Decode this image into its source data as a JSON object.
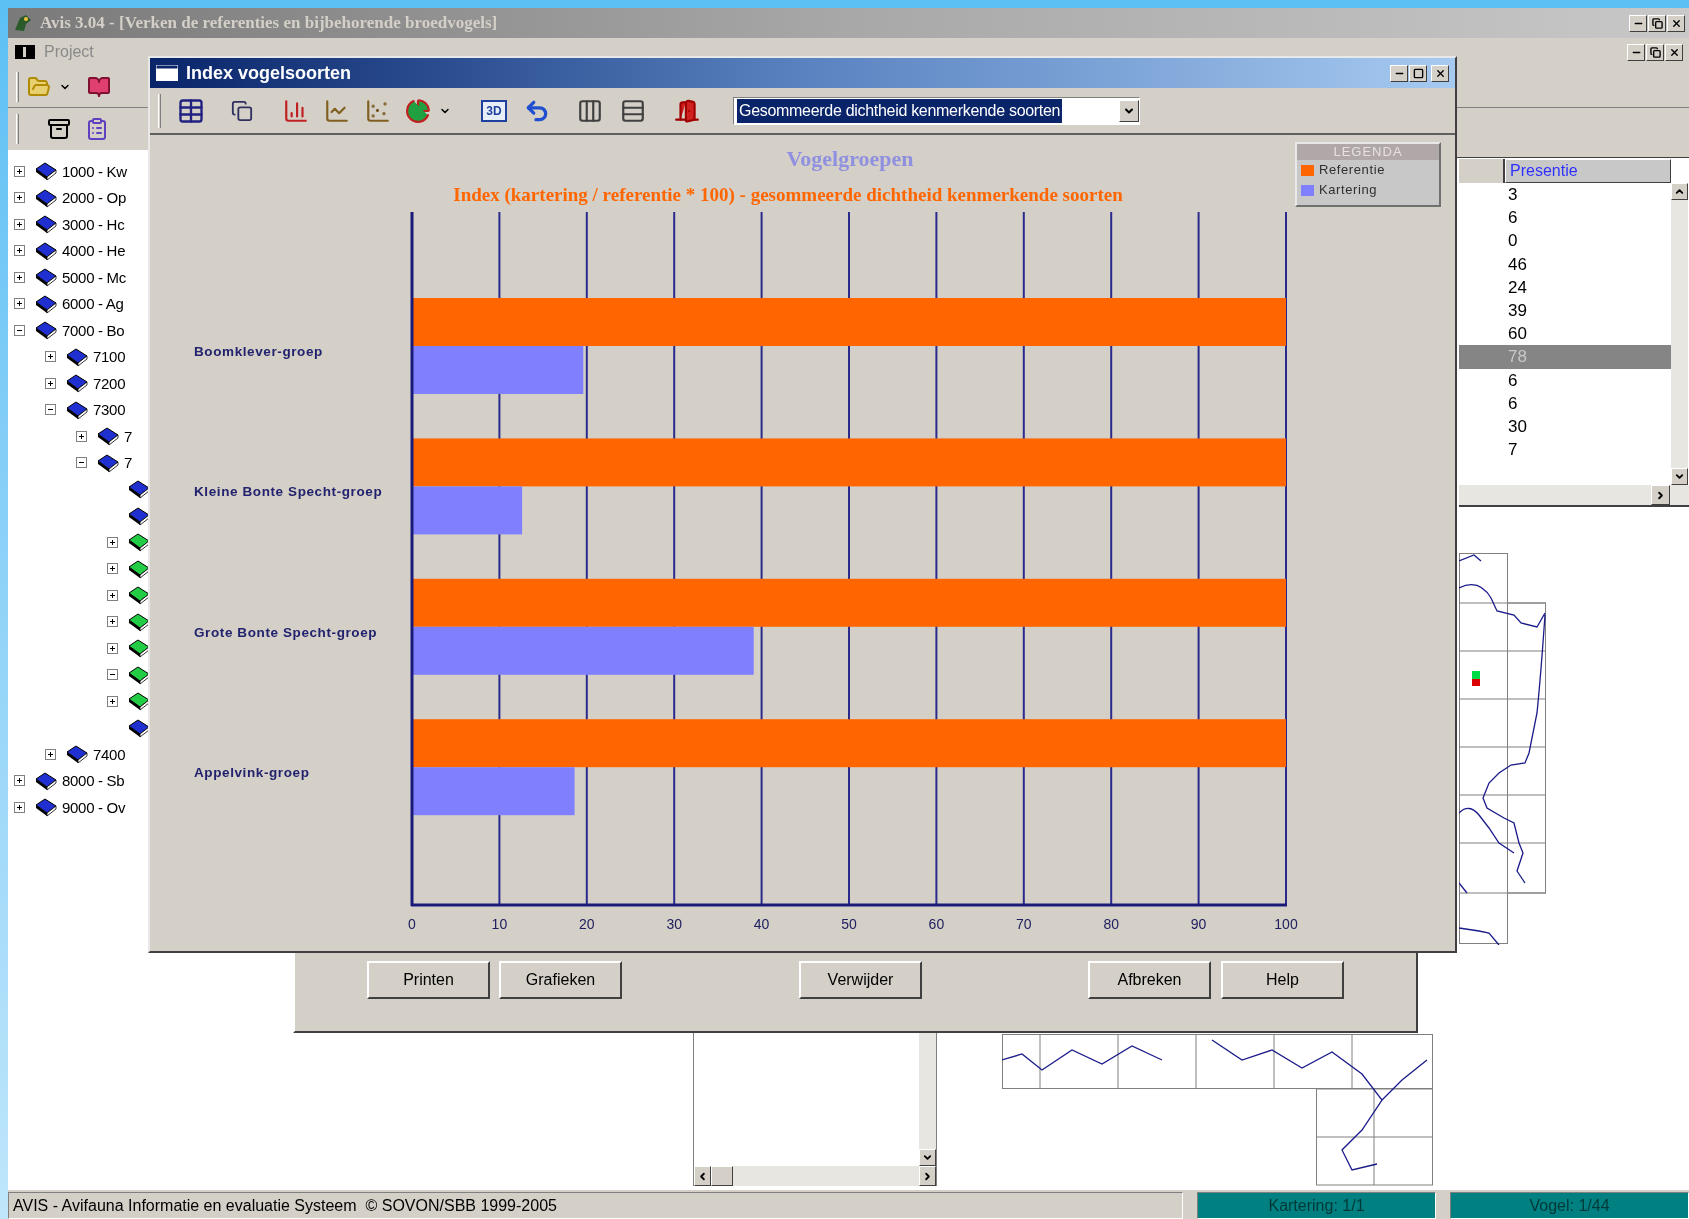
{
  "app": {
    "title": "Avis 3.04 - [Verken de referenties en bijbehorende broedvogels]",
    "menu": [
      "Project"
    ]
  },
  "tree": [
    {
      "label": "1000 - Kw",
      "kind": "collapsed",
      "color": "#1f2fd0"
    },
    {
      "label": "2000 - Op",
      "kind": "collapsed",
      "color": "#1f2fd0"
    },
    {
      "label": "3000 - Hc",
      "kind": "collapsed",
      "color": "#1f2fd0"
    },
    {
      "label": "4000 - He",
      "kind": "collapsed",
      "color": "#1f2fd0"
    },
    {
      "label": "5000 - Mc",
      "kind": "collapsed",
      "color": "#1f2fd0"
    },
    {
      "label": "6000 - Ag",
      "kind": "collapsed",
      "color": "#1f2fd0"
    },
    {
      "label": "7000 - Bo",
      "kind": "expanded",
      "color": "#1f2fd0",
      "children": [
        {
          "label": "7100",
          "kind": "collapsed",
          "color": "#1f2fd0"
        },
        {
          "label": "7200",
          "kind": "collapsed",
          "color": "#1f2fd0"
        },
        {
          "label": "7300",
          "kind": "expanded",
          "color": "#1f2fd0",
          "children": [
            {
              "label": "7",
              "kind": "collapsed",
              "color": "#1f2fd0"
            },
            {
              "label": "7",
              "kind": "expanded",
              "color": "#1f2fd0",
              "children": [
                {
                  "kind": "leaf",
                  "color": "#1f2fd0"
                },
                {
                  "kind": "leaf",
                  "color": "#1f2fd0"
                },
                {
                  "kind": "collapsed",
                  "color": "#22cc44"
                },
                {
                  "kind": "collapsed",
                  "color": "#22cc44"
                },
                {
                  "kind": "collapsed",
                  "color": "#22cc44"
                },
                {
                  "kind": "collapsed",
                  "color": "#22cc44"
                },
                {
                  "kind": "collapsed",
                  "color": "#22cc44"
                },
                {
                  "kind": "expanded",
                  "color": "#22cc44"
                },
                {
                  "kind": "collapsed",
                  "color": "#22cc44"
                },
                {
                  "kind": "leaf",
                  "color": "#1f2fd0"
                }
              ]
            }
          ]
        },
        {
          "label": "7400",
          "kind": "collapsed",
          "color": "#1f2fd0"
        }
      ]
    },
    {
      "label": "8000 - Sb",
      "kind": "collapsed",
      "color": "#1f2fd0"
    },
    {
      "label": "9000 - Ov",
      "kind": "collapsed",
      "color": "#1f2fd0"
    }
  ],
  "list": {
    "columns": [
      "Presentie"
    ],
    "rows": [
      {
        "value": "3",
        "selected": false
      },
      {
        "value": "6",
        "selected": false
      },
      {
        "value": "0",
        "selected": false
      },
      {
        "value": "46",
        "selected": false
      },
      {
        "value": "24",
        "selected": false
      },
      {
        "value": "39",
        "selected": false
      },
      {
        "value": "60",
        "selected": false
      },
      {
        "value": "78",
        "selected": true
      },
      {
        "value": "6",
        "selected": false
      },
      {
        "value": "6",
        "selected": false
      },
      {
        "value": "30",
        "selected": false
      },
      {
        "value": "7",
        "selected": false
      }
    ]
  },
  "back_dialog": {
    "buttons": [
      "Printen",
      "Grafieken",
      "Verwijder",
      "Afbreken",
      "Help"
    ]
  },
  "dialog": {
    "title": "Index vogelsoorten",
    "toolbar_3d": "3D",
    "measure": {
      "value": "Gesommeerde dichtheid kenmerkende soorten"
    },
    "legend": {
      "title": "LEGENDA"
    },
    "chart_data": {
      "type": "bar",
      "orientation": "horizontal",
      "title": "Vogelgroepen",
      "subtitle": "Index (kartering / referentie * 100) - gesommeerde dichtheid kenmerkende soorten",
      "categories": [
        "Boomklever-groep",
        "Kleine Bonte Specht-groep",
        "Grote Bonte Specht-groep",
        "Appelvink-groep"
      ],
      "series": [
        {
          "name": "Referentie",
          "color": "#ff6600",
          "values": [
            100,
            100,
            100,
            100
          ]
        },
        {
          "name": "Kartering",
          "color": "#8080ff",
          "values": [
            19.6,
            12.6,
            39.1,
            18.6
          ]
        }
      ],
      "xlim": [
        0,
        100
      ],
      "grid": true,
      "xticks": [
        0,
        10,
        20,
        30,
        40,
        50,
        60,
        70,
        80,
        90,
        100
      ]
    }
  },
  "status_bar": {
    "text": "AVIS - Avifauna Informatie en evaluatie Systeem  © SOVON/SBB 1999-2005",
    "panels": [
      "Kartering: 1/1",
      "Vogel: 1/44"
    ]
  }
}
